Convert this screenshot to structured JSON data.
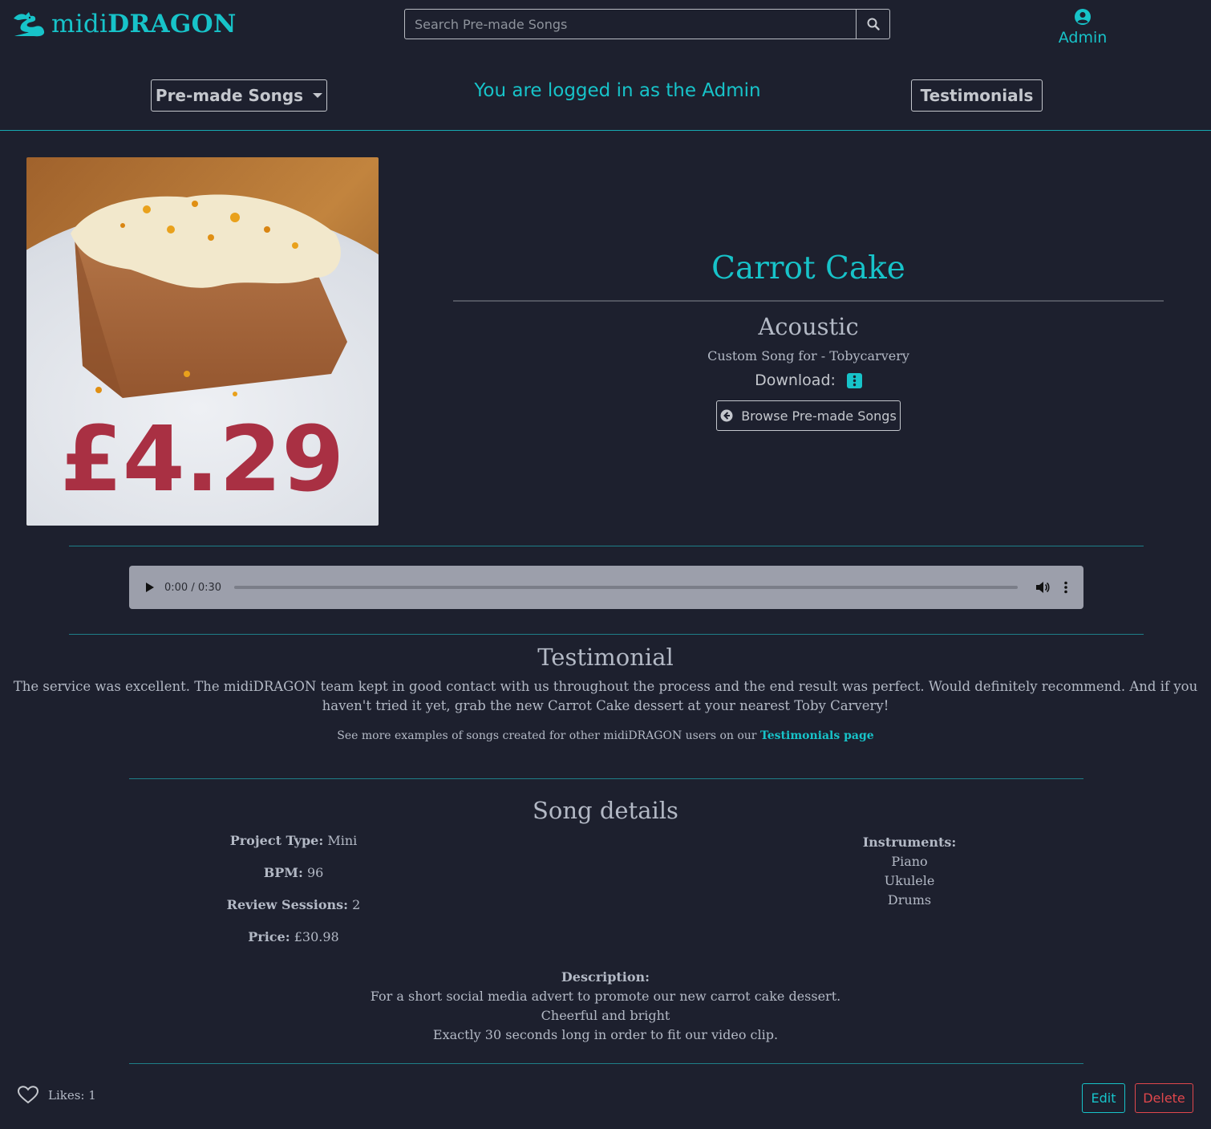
{
  "header": {
    "brand_prefix": "midi",
    "brand_suffix": "DRAGON",
    "search_placeholder": "Search Pre-made Songs",
    "account_label": "Admin",
    "nav_premade_label": "Pre-made Songs",
    "logged_in_text": "You are logged in as the Admin",
    "nav_testimonials_label": "Testimonials"
  },
  "product_image": {
    "price_overlay": "£4.29"
  },
  "song": {
    "title": "Carrot Cake",
    "genre": "Acoustic",
    "custom_for": "Custom Song for - Tobycarvery",
    "download_label": "Download:",
    "browse_label": "Browse Pre-made Songs"
  },
  "audio": {
    "time": "0:00 / 0:30",
    "progress": 0
  },
  "testimonial": {
    "heading": "Testimonial",
    "body": "The service was excellent. The midiDRAGON team kept in good contact with us throughout the process and the end result was perfect. Would definitely recommend. And if you haven't tried it yet, grab the new Carrot Cake dessert at your nearest Toby Carvery!",
    "more_prefix": "See more examples of songs created for other midiDRAGON users on our",
    "more_link": "Testimonials page"
  },
  "details": {
    "heading": "Song details",
    "project_type_label": "Project Type:",
    "project_type": "Mini",
    "bpm_label": "BPM:",
    "bpm": "96",
    "review_label": "Review Sessions:",
    "review_sessions": "2",
    "price_label": "Price:",
    "price": "£30.98",
    "instruments_label": "Instruments:",
    "instruments": [
      "Piano",
      "Ukulele",
      "Drums"
    ],
    "description_label": "Description:",
    "description": [
      "For a short social media advert to promote our new carrot cake dessert.",
      "Cheerful and bright",
      "Exactly 30 seconds long in order to fit our video clip."
    ]
  },
  "footer": {
    "likes_text": "Likes: 1",
    "edit_label": "Edit",
    "delete_label": "Delete"
  },
  "colors": {
    "background": "#1d202e",
    "accent": "#17c3c9",
    "danger": "#e0474c",
    "text": "#b3b9c5"
  }
}
